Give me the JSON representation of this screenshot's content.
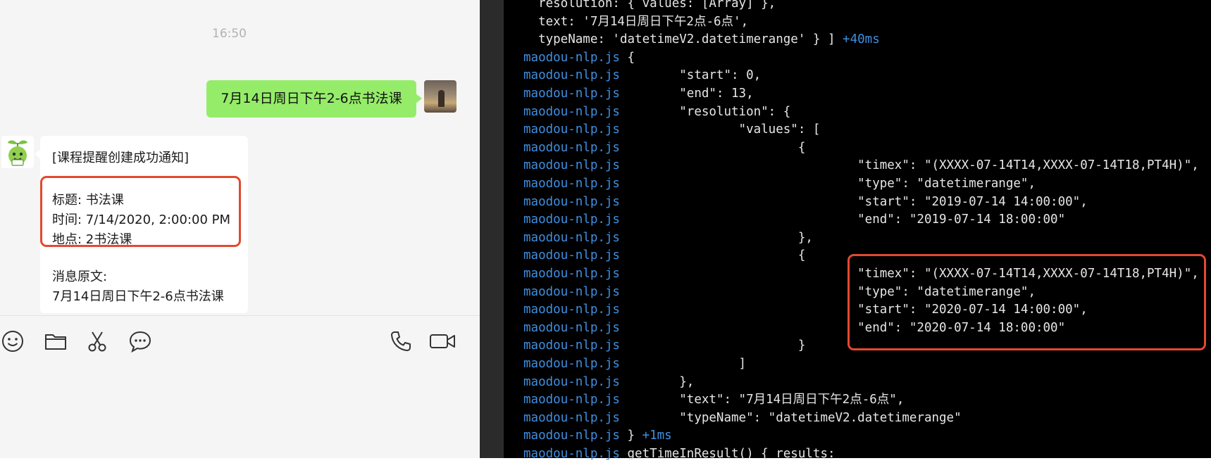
{
  "chat": {
    "time": "16:50",
    "outgoing_message": "7月14日周日下午2-6点书法课",
    "incoming_message": {
      "header": "[课程提醒创建成功通知]",
      "title_line": "标题: 书法课",
      "time_line": "时间: 7/14/2020, 2:00:00 PM",
      "place_line": "地点: 2书法课",
      "original_label": "消息原文:",
      "original_text": "7月14日周日下午2-6点书法课"
    },
    "toolbar": {
      "left_icons": [
        "emoji-icon",
        "folder-icon",
        "scissors-icon",
        "chat-bubble-icon"
      ],
      "right_icons": [
        "phone-icon",
        "video-call-icon"
      ]
    },
    "colors": {
      "outgoing_bubble": "#95ec69",
      "highlight_box": "#e4492f"
    }
  },
  "terminal": {
    "prefix": "maodou-nlp.js",
    "colors": {
      "prefix": "#3f8fe0",
      "text": "#e6e6e6",
      "background": "#000000",
      "highlight_box": "#e4492f"
    },
    "lines": [
      {
        "pfx": "",
        "text": "  resolution: { values: [Array] },",
        "tm": ""
      },
      {
        "pfx": "",
        "text": "  text: '7月14日周日下午2点-6点',",
        "tm": ""
      },
      {
        "pfx": "",
        "text": "  typeName: 'datetimeV2.datetimerange' } ] ",
        "tm": "+40ms"
      },
      {
        "pfx": "maodou-nlp.js",
        "text": " {",
        "tm": ""
      },
      {
        "pfx": "maodou-nlp.js",
        "text": "        \"start\": 0,",
        "tm": ""
      },
      {
        "pfx": "maodou-nlp.js",
        "text": "        \"end\": 13,",
        "tm": ""
      },
      {
        "pfx": "maodou-nlp.js",
        "text": "        \"resolution\": {",
        "tm": ""
      },
      {
        "pfx": "maodou-nlp.js",
        "text": "                \"values\": [",
        "tm": ""
      },
      {
        "pfx": "maodou-nlp.js",
        "text": "                        {",
        "tm": ""
      },
      {
        "pfx": "maodou-nlp.js",
        "text": "                                \"timex\": \"(XXXX-07-14T14,XXXX-07-14T18,PT4H)\",",
        "tm": ""
      },
      {
        "pfx": "maodou-nlp.js",
        "text": "                                \"type\": \"datetimerange\",",
        "tm": ""
      },
      {
        "pfx": "maodou-nlp.js",
        "text": "                                \"start\": \"2019-07-14 14:00:00\",",
        "tm": ""
      },
      {
        "pfx": "maodou-nlp.js",
        "text": "                                \"end\": \"2019-07-14 18:00:00\"",
        "tm": ""
      },
      {
        "pfx": "maodou-nlp.js",
        "text": "                        },",
        "tm": ""
      },
      {
        "pfx": "maodou-nlp.js",
        "text": "                        {",
        "tm": ""
      },
      {
        "pfx": "maodou-nlp.js",
        "text": "                                \"timex\": \"(XXXX-07-14T14,XXXX-07-14T18,PT4H)\",",
        "tm": ""
      },
      {
        "pfx": "maodou-nlp.js",
        "text": "                                \"type\": \"datetimerange\",",
        "tm": ""
      },
      {
        "pfx": "maodou-nlp.js",
        "text": "                                \"start\": \"2020-07-14 14:00:00\",",
        "tm": ""
      },
      {
        "pfx": "maodou-nlp.js",
        "text": "                                \"end\": \"2020-07-14 18:00:00\"",
        "tm": ""
      },
      {
        "pfx": "maodou-nlp.js",
        "text": "                        }",
        "tm": ""
      },
      {
        "pfx": "maodou-nlp.js",
        "text": "                ]",
        "tm": ""
      },
      {
        "pfx": "maodou-nlp.js",
        "text": "        },",
        "tm": ""
      },
      {
        "pfx": "maodou-nlp.js",
        "text": "        \"text\": \"7月14日周日下午2点-6点\",",
        "tm": ""
      },
      {
        "pfx": "maodou-nlp.js",
        "text": "        \"typeName\": \"datetimeV2.datetimerange\"",
        "tm": ""
      },
      {
        "pfx": "maodou-nlp.js",
        "text": " } ",
        "tm": "+1ms"
      },
      {
        "pfx": "maodou-nlp.js",
        "text": " getTimeInResult() { results:",
        "tm": ""
      }
    ]
  }
}
